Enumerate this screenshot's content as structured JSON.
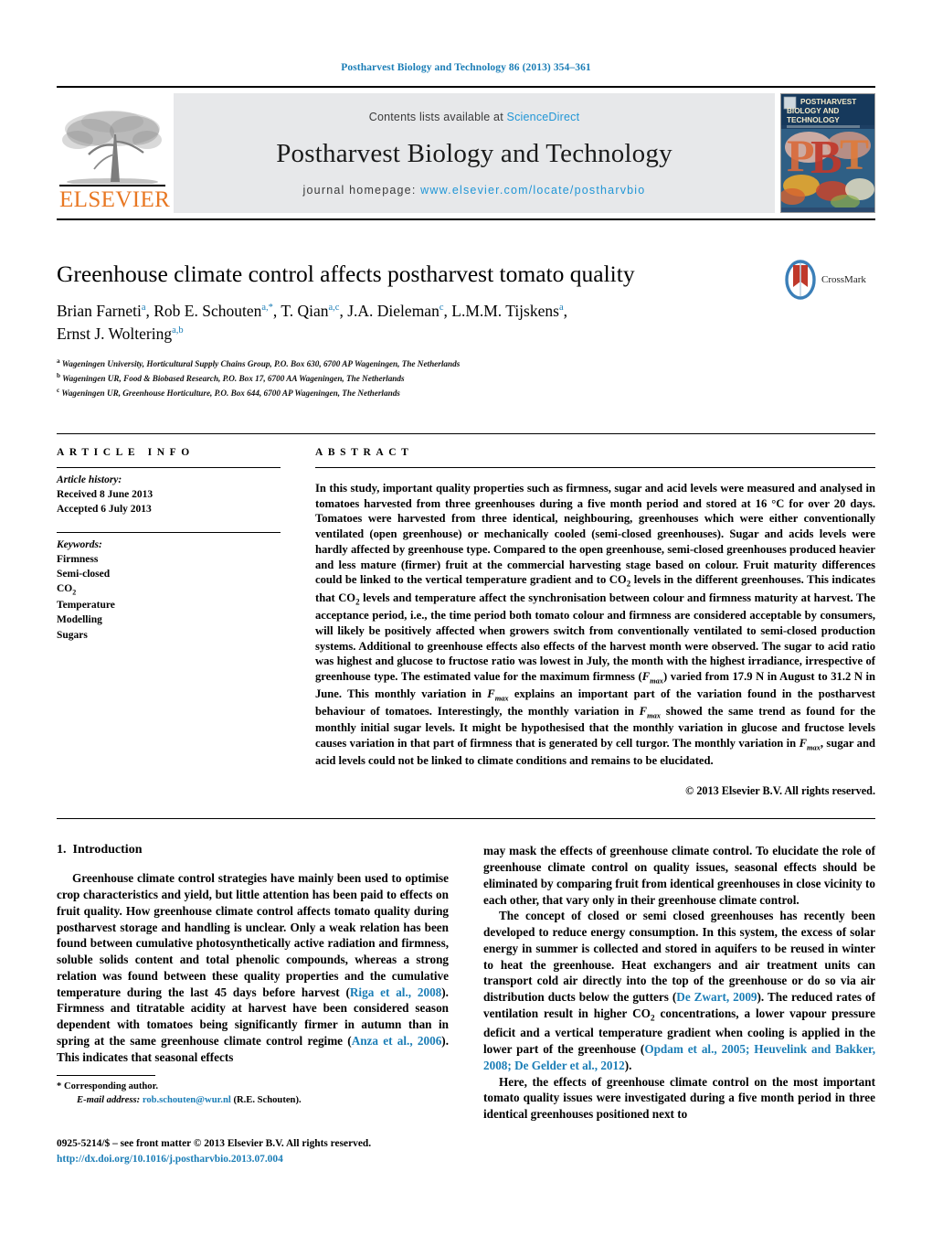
{
  "running_head": "Postharvest Biology and Technology 86 (2013) 354–361",
  "masthead": {
    "publisher_name": "ELSEVIER",
    "contents_prefix": "Contents lists available at ",
    "contents_link": "ScienceDirect",
    "journal_title": "Postharvest Biology and Technology",
    "homepage_prefix": "journal homepage: ",
    "homepage_url": "www.elsevier.com/locate/postharvbio",
    "cover_title_line1": "POSTHARVEST",
    "cover_title_line2": "BIOLOGY AND",
    "cover_title_line3": "TECHNOLOGY",
    "cover_letters": "PBT"
  },
  "article": {
    "title": "Greenhouse climate control affects postharvest tomato quality",
    "authors_line1_a": "Brian Farneti",
    "authors_line1_a_sup": "a",
    "authors_line1_b": ", Rob E. Schouten",
    "authors_line1_b_sup": "a,*",
    "authors_line1_c": ", T. Qian",
    "authors_line1_c_sup": "a,c",
    "authors_line1_d": ", J.A. Dieleman",
    "authors_line1_d_sup": "c",
    "authors_line1_e": ", L.M.M. Tijskens",
    "authors_line1_e_sup": "a",
    "authors_line1_f": ",",
    "authors_line2": "Ernst J. Woltering",
    "authors_line2_sup": "a,b",
    "affiliations": [
      {
        "marker": "a",
        "text": "Wageningen University, Horticultural Supply Chains Group, P.O. Box 630, 6700 AP Wageningen, The Netherlands"
      },
      {
        "marker": "b",
        "text": "Wageningen UR, Food & Biobased Research, P.O. Box 17, 6700 AA Wageningen, The Netherlands"
      },
      {
        "marker": "c",
        "text": "Wageningen UR, Greenhouse Horticulture, P.O. Box 644, 6700 AP Wageningen, The Netherlands"
      }
    ],
    "crossmark_label": "CrossMark"
  },
  "article_info": {
    "heading": "ARTICLE INFO",
    "history_label": "Article history:",
    "history": [
      "Received 8 June 2013",
      "Accepted 6 July 2013"
    ],
    "keywords_label": "Keywords:",
    "keywords": [
      "Firmness",
      "Semi-closed",
      "CO2",
      "Temperature",
      "Modelling",
      "Sugars"
    ]
  },
  "abstract": {
    "heading": "ABSTRACT",
    "text_part1": "In this study, important quality properties such as firmness, sugar and acid levels were measured and analysed in tomatoes harvested from three greenhouses during a five month period and stored at 16 °C for over 20 days. Tomatoes were harvested from three identical, neighbouring, greenhouses which were either conventionally ventilated (open greenhouse) or mechanically cooled (semi-closed greenhouses). Sugar and acids levels were hardly affected by greenhouse type. Compared to the open greenhouse, semi-closed greenhouses produced heavier and less mature (firmer) fruit at the commercial harvesting stage based on colour. Fruit maturity differences could be linked to the vertical temperature gradient and to CO",
    "sub1": "2",
    "text_part2": " levels in the different greenhouses. This indicates that CO",
    "sub2": "2",
    "text_part3": " levels and temperature affect the synchronisation between colour and firmness maturity at harvest. The acceptance period, i.e., the time period both tomato colour and firmness are considered acceptable by consumers, will likely be positively affected when growers switch from conventionally ventilated to semi-closed production systems. Additional to greenhouse effects also effects of the harvest month were observed. The sugar to acid ratio was highest and glucose to fructose ratio was lowest in July, the month with the highest irradiance, irrespective of greenhouse type. The estimated value for the maximum firmness (",
    "fmax1": "Fmax",
    "text_part4": ") varied from 17.9 N in August to 31.2 N in June. This monthly variation in ",
    "fmax2": "Fmax",
    "text_part5": " explains an important part of the variation found in the postharvest behaviour of tomatoes. Interestingly, the monthly variation in ",
    "fmax3": "Fmax",
    "text_part6": " showed the same trend as found for the monthly initial sugar levels. It might be hypothesised that the monthly variation in glucose and fructose levels causes variation in that part of firmness that is generated by cell turgor. The monthly variation in ",
    "fmax4": "Fmax",
    "text_part7": ", sugar and acid levels could not be linked to climate conditions and remains to be elucidated.",
    "copyright": "© 2013 Elsevier B.V. All rights reserved."
  },
  "introduction": {
    "number": "1.",
    "heading": "Introduction",
    "left_p1_a": "Greenhouse climate control strategies have mainly been used to optimise crop characteristics and yield, but little attention has been paid to effects on fruit quality. How greenhouse climate control affects tomato quality during postharvest storage and handling is unclear. Only a weak relation has been found between cumulative photosynthetically active radiation and firmness, soluble solids content and total phenolic compounds, whereas a strong relation was found between these quality properties and the cumulative temperature during the last 45 days before harvest (",
    "ref1": "Riga et al., 2008",
    "left_p1_b": "). Firmness and titratable acidity at harvest have been considered season dependent with tomatoes being significantly firmer in autumn than in spring at the same greenhouse climate control regime (",
    "ref2": "Anza et al., 2006",
    "left_p1_c": "). This indicates that seasonal effects",
    "right_p1_a": "may mask the effects of greenhouse climate control. To elucidate the role of greenhouse climate control on quality issues, seasonal effects should be eliminated by comparing fruit from identical greenhouses in close vicinity to each other, that vary only in their greenhouse climate control.",
    "right_p2_a": "The concept of closed or semi closed greenhouses has recently been developed to reduce energy consumption. In this system, the excess of solar energy in summer is collected and stored in aquifers to be reused in winter to heat the greenhouse. Heat exchangers and air treatment units can transport cold air directly into the top of the greenhouse or do so via air distribution ducts below the gutters (",
    "ref3": "De Zwart, 2009",
    "right_p2_b": "). The reduced rates of ventilation result in higher CO",
    "sub_co2": "2",
    "right_p2_c": " concentrations, a lower vapour pressure deficit and a vertical temperature gradient when cooling is applied in the lower part of the greenhouse (",
    "ref4": "Opdam et al., 2005; Heuvelink and Bakker, 2008;",
    "ref5": "De Gelder et al., 2012",
    "right_p2_d": ").",
    "right_p3_a": "Here, the effects of greenhouse climate control on the most important tomato quality issues were investigated during a five month period in three identical greenhouses positioned next to"
  },
  "footnotes": {
    "corresponding": "* Corresponding author.",
    "email_label": "E-mail address:",
    "email": "rob.schouten@wur.nl",
    "email_suffix": "(R.E. Schouten).",
    "issn_line": "0925-5214/$ – see front matter © 2013 Elsevier B.V. All rights reserved.",
    "doi": "http://dx.doi.org/10.1016/j.postharvbio.2013.07.004"
  },
  "colors": {
    "link_blue": "#1a7db6",
    "sciencedirect_blue": "#2196d6",
    "elsevier_orange": "#E87722",
    "band_grey": "#e7e8ea"
  }
}
